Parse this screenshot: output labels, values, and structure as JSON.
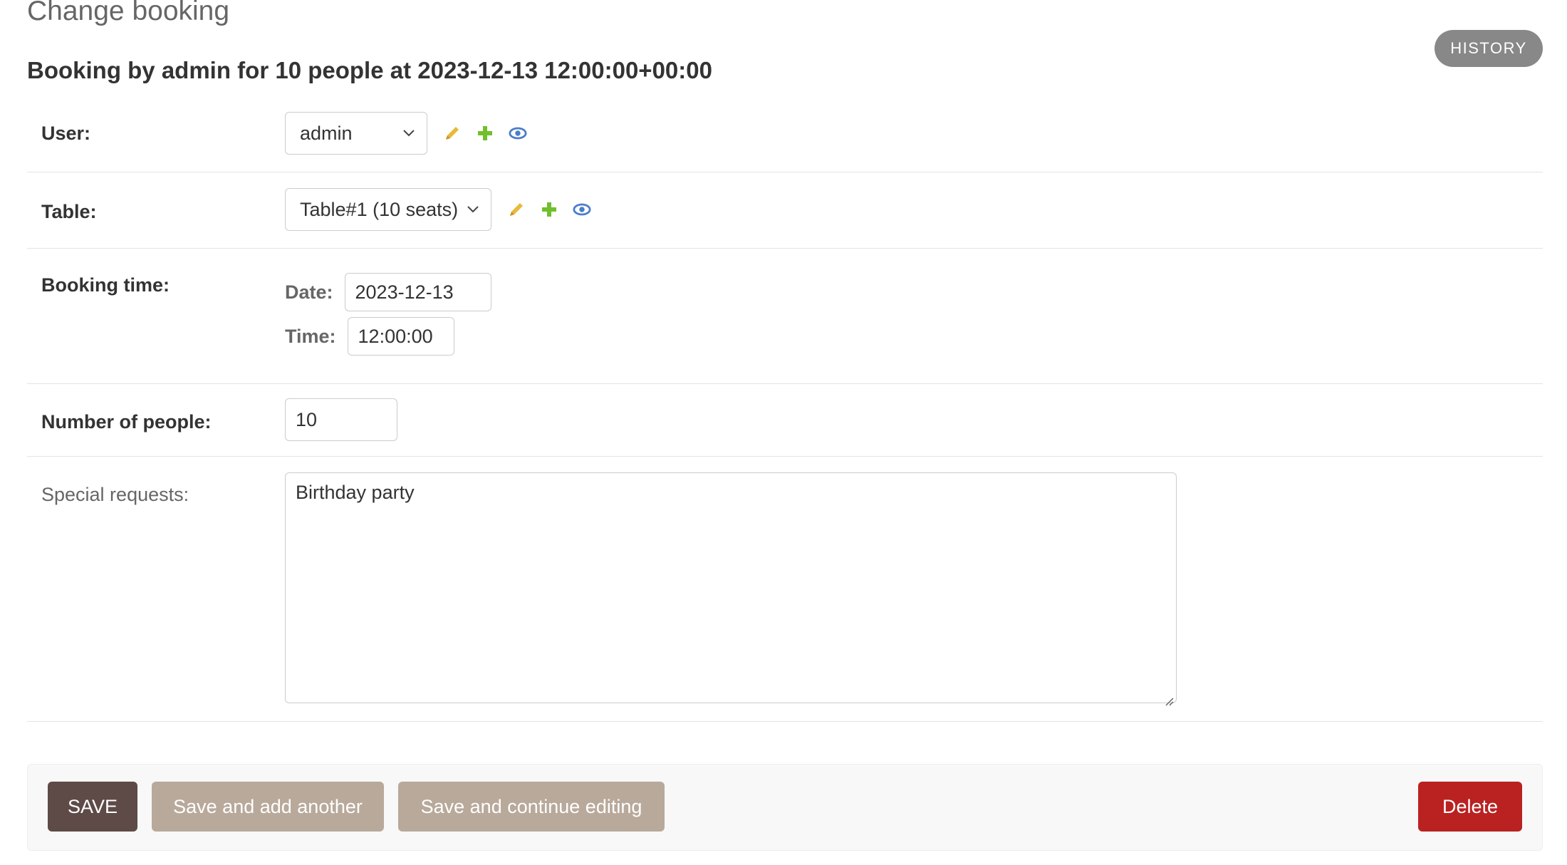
{
  "page": {
    "title": "Change booking",
    "history_label": "HISTORY",
    "object_heading": "Booking by admin for 10 people at 2023-12-13 12:00:00+00:00"
  },
  "fields": {
    "user": {
      "label": "User:",
      "value": "admin"
    },
    "table": {
      "label": "Table:",
      "value": "Table#1 (10 seats)"
    },
    "booking_time": {
      "label": "Booking time:",
      "date_label": "Date:",
      "date_value": "2023-12-13",
      "time_label": "Time:",
      "time_value": "12:00:00"
    },
    "people": {
      "label": "Number of people:",
      "value": "10"
    },
    "special_requests": {
      "label": "Special requests:",
      "value": "Birthday party"
    }
  },
  "actions": {
    "save": "SAVE",
    "save_add": "Save and add another",
    "save_continue": "Save and continue editing",
    "delete": "Delete"
  },
  "colors": {
    "save_button": "#5e4a47",
    "secondary_button": "#b8a99b",
    "delete_button": "#ba2121",
    "history_button": "#888888",
    "edit_icon": "#e8b93a",
    "add_icon": "#70bf2b",
    "view_icon": "#4a7ec9"
  },
  "icons": [
    "pencil-icon",
    "plus-icon",
    "eye-icon",
    "chevron-down-icon"
  ]
}
